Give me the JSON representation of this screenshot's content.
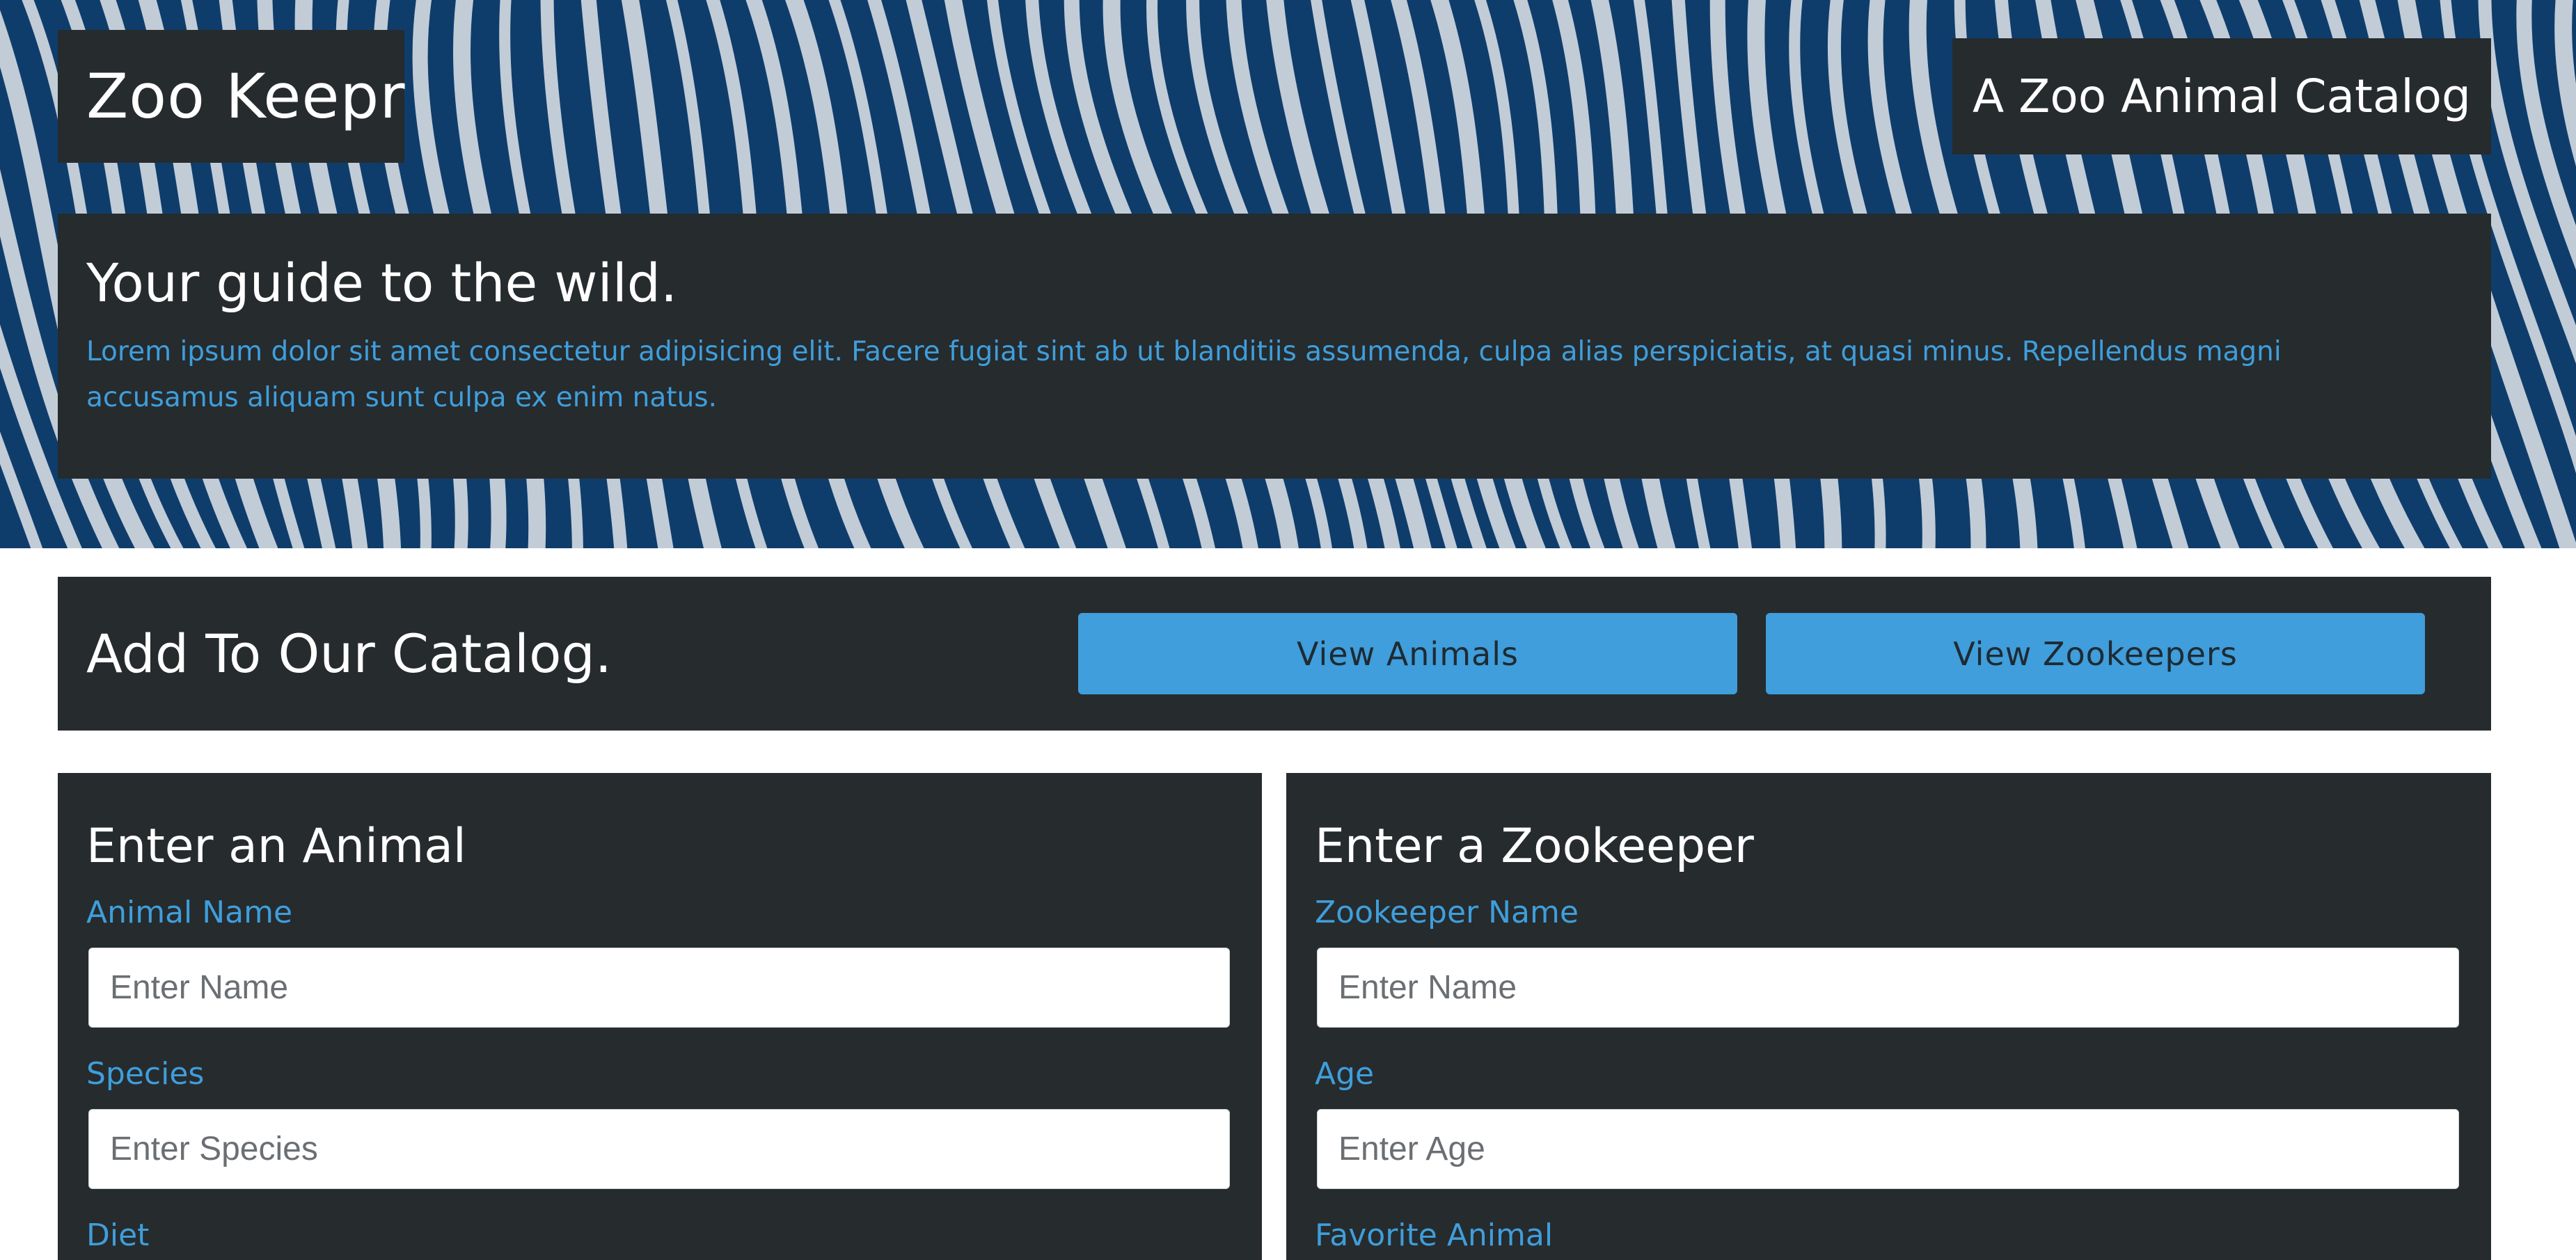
{
  "brand": {
    "title": "Zoo Keepr",
    "tagline": "A Zoo Animal Catalog"
  },
  "intro": {
    "heading": "Your guide to the wild.",
    "text": "Lorem ipsum dolor sit amet consectetur adipisicing elit. Facere fugiat sint ab ut blanditiis assumenda, culpa alias perspiciatis, at quasi minus. Repellendus magni accusamus aliquam sunt culpa ex enim natus."
  },
  "catalog": {
    "heading": "Add To Our Catalog.",
    "view_animals_label": "View Animals",
    "view_zookeepers_label": "View Zookeepers"
  },
  "animal_form": {
    "heading": "Enter an Animal",
    "name_label": "Animal Name",
    "name_placeholder": "Enter Name",
    "name_value": "",
    "species_label": "Species",
    "species_placeholder": "Enter Species",
    "species_value": "",
    "next_label_partial": "Diet"
  },
  "zookeeper_form": {
    "heading": "Enter a Zookeeper",
    "name_label": "Zookeeper Name",
    "name_placeholder": "Enter Name",
    "name_value": "",
    "age_label": "Age",
    "age_placeholder": "Enter Age",
    "age_value": "",
    "next_label_partial": "Favorite Animal"
  },
  "colors": {
    "panel_background": "#262b2e",
    "accent": "#3f9edb",
    "hero_blue": "#0f3d6b",
    "stripe": "#e9ecef"
  },
  "hero_image": "zebra-stripes-background"
}
